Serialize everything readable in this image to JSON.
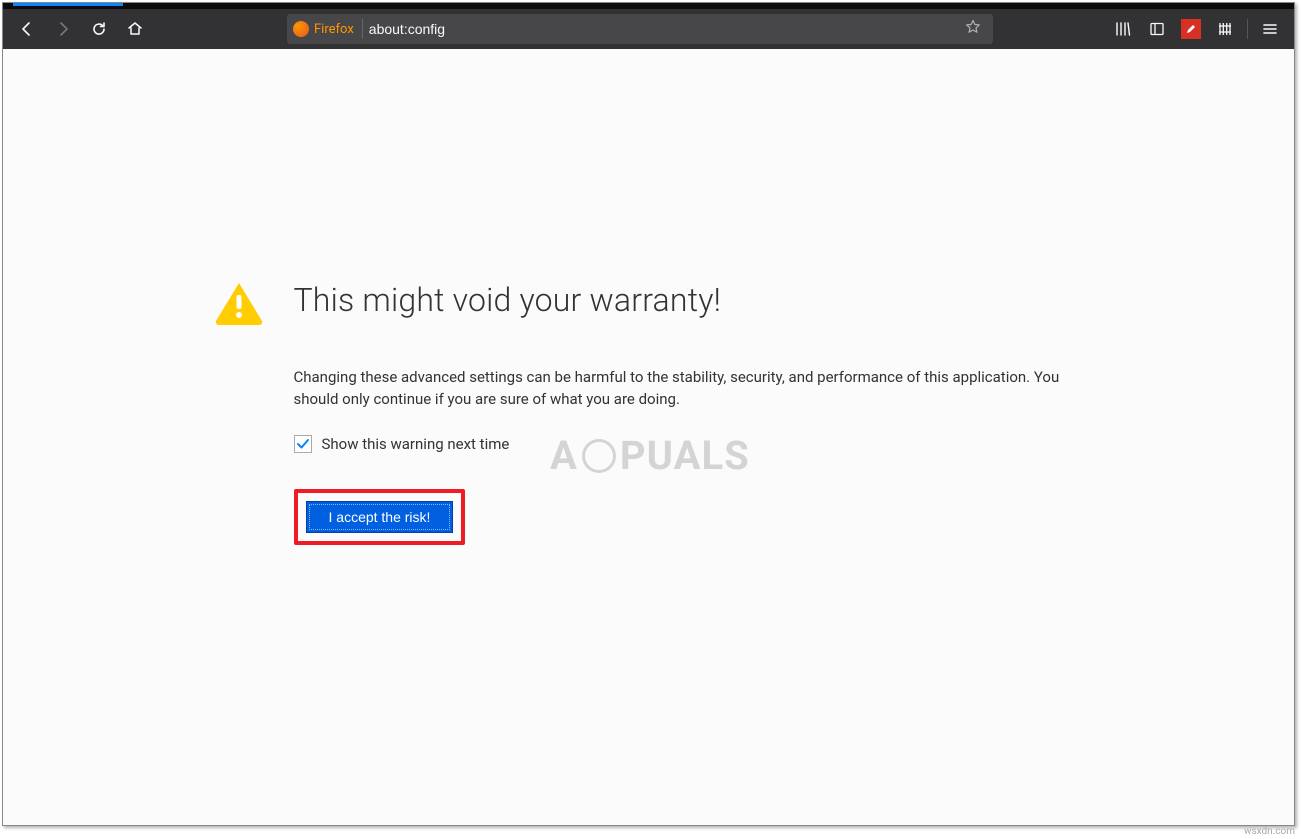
{
  "toolbar": {
    "identity_label": "Firefox",
    "url": "about:config"
  },
  "warning": {
    "title": "This might void your warranty!",
    "body": "Changing these advanced settings can be harmful to the stability, security, and performance of this application. You should only continue if you are sure of what you are doing.",
    "checkbox_label": "Show this warning next time",
    "checkbox_checked": true,
    "accept_label": "I accept the risk!"
  },
  "watermark": {
    "prefix": "A",
    "suffix": "PUALS"
  },
  "attribution": "wsxdn.com"
}
